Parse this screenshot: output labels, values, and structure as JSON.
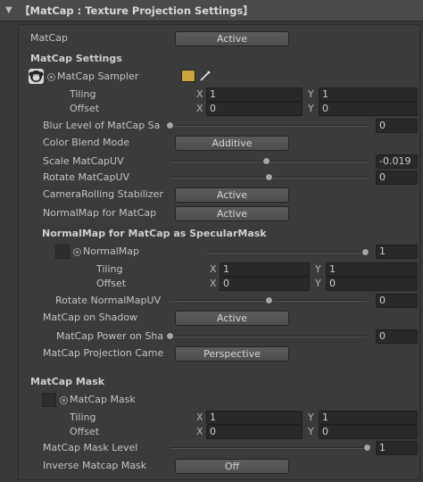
{
  "header": {
    "fold_glyph": "▼",
    "title": "【MatCap : Texture Projection Settings】"
  },
  "matcap": {
    "label": "MatCap",
    "value": "Active"
  },
  "settings": {
    "heading": "MatCap Settings",
    "sampler_label": "MatCap Sampler",
    "tiling_label": "Tiling",
    "tiling_x": "1",
    "tiling_y": "1",
    "offset_label": "Offset",
    "offset_x": "0",
    "offset_y": "0",
    "blur_label": "Blur Level of MatCap Sa",
    "blur_value": "0",
    "blur_fraction": 0.0,
    "blend_label": "Color Blend Mode",
    "blend_value": "Additive",
    "scale_label": "Scale MatCapUV",
    "scale_value": "-0.019",
    "scale_fraction": 0.49,
    "rotate_label": "Rotate MatCapUV",
    "rotate_value": "0",
    "rotate_fraction": 0.5,
    "camroll_label": "CameraRolling Stabilizer",
    "camroll_value": "Active",
    "normalmap_label": "NormalMap for MatCap",
    "normalmap_value": "Active"
  },
  "specular": {
    "heading": "NormalMap for MatCap as SpecularMask",
    "normalmap_label": "NormalMap",
    "normalmap_value": "1",
    "normalmap_fraction": 1.0,
    "tiling_label": "Tiling",
    "tiling_x": "1",
    "tiling_y": "1",
    "offset_label": "Offset",
    "offset_x": "0",
    "offset_y": "0",
    "rotate_label": "Rotate NormalMapUV",
    "rotate_value": "0",
    "rotate_fraction": 0.5,
    "shadow_label": "MatCap on Shadow",
    "shadow_value": "Active",
    "power_label": "MatCap Power on Sha",
    "power_value": "0",
    "power_fraction": 0.0,
    "projection_label": "MatCap Projection Came",
    "projection_value": "Perspective"
  },
  "mask": {
    "heading": "MatCap Mask",
    "mask_label": "MatCap Mask",
    "tiling_label": "Tiling",
    "tiling_x": "1",
    "tiling_y": "1",
    "offset_label": "Offset",
    "offset_x": "0",
    "offset_y": "0",
    "level_label": "MatCap Mask Level",
    "level_value": "1",
    "level_fraction": 1.0,
    "inverse_label": "Inverse Matcap Mask",
    "inverse_value": "Off"
  },
  "axes": {
    "x": "X",
    "y": "Y"
  },
  "icons": {
    "sampler_preview": "monkey-matcap-icon",
    "object_picker": "object-picker-icon",
    "color_swatch": "color-swatch",
    "eyedropper": "eyedropper-icon"
  },
  "colors": {
    "swatch": "#c8a43a"
  }
}
